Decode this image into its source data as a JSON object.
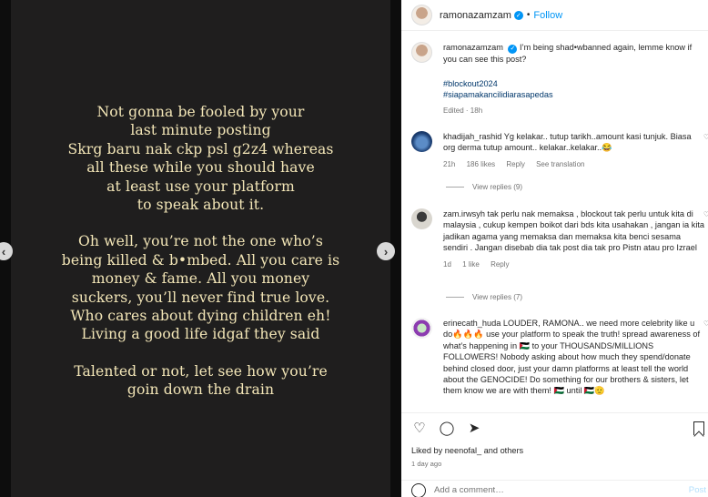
{
  "story": {
    "block1": [
      "Not gonna be fooled by your",
      "last minute posting",
      "Skrg baru nak ckp psl g2z4 whereas",
      "all these while you should have",
      "at least use your platform",
      "to speak about it."
    ],
    "block2": [
      "Oh well, you’re not the one who’s",
      "being killed & b•mbed. All you care is",
      "money & fame. All you money",
      "suckers, you’ll never find true love.",
      "Who cares about dying children eh!",
      "Living a good life idgaf they said"
    ],
    "block3": [
      "Talented or not, let see how you’re",
      "goin down the drain"
    ],
    "prev_icon": "‹",
    "next_icon": "›"
  },
  "header": {
    "username": "ramonazamzam",
    "follow_label": "Follow",
    "separator": "•"
  },
  "caption": {
    "username": "ramonazamzam",
    "text": "I’m being shad•wbanned again, lemme know if you can see this post?",
    "hashtags": [
      "#blockout2024",
      "#siapamakancilidiarasapedas"
    ],
    "meta": "Edited · 18h"
  },
  "comments": [
    {
      "username": "khadijah_rashid",
      "text": "Yg kelakar.. tutup tarikh..amount kasi tunjuk. Biasa org derma tutup amount.. kelakar..kelakar..😂",
      "time": "21h",
      "likes": "186 likes",
      "reply": "Reply",
      "translation": "See translation",
      "view_replies": "View replies (9)"
    },
    {
      "username": "zam.irwsyh",
      "text": "tak perlu nak memaksa , blockout tak perlu untuk kita di malaysia , cukup kempen boikot dari bds kita usahakan , jangan ia kita jadikan agama yang memaksa dan memaksa kita benci sesama sendiri . Jangan disebab dia tak post dia tak pro Pistn atau pro Izrael",
      "time": "1d",
      "likes": "1 like",
      "reply": "Reply",
      "view_replies": "View replies (7)"
    },
    {
      "username": "erinecath_huda",
      "text": "LOUDER, RAMONA.. we need more celebrity like u do🔥🔥🔥 use your platform to speak the truth! spread awareness of what’s happening in 🇵🇸 to your THOUSANDS/MILLIONS FOLLOWERS! Nobody asking about how much they spend/donate behind closed door, just your damn platforms at least tell the world about the GENOCIDE! Do something for our brothers & sisters, let them know we are with them! 🇵🇸 until 🇵🇸🫡"
    }
  ],
  "actions": {
    "liked_by": "Liked by neenofal_ and others",
    "time": "1 day ago",
    "add_comment_placeholder": "Add a comment…",
    "post_label": "Post"
  }
}
